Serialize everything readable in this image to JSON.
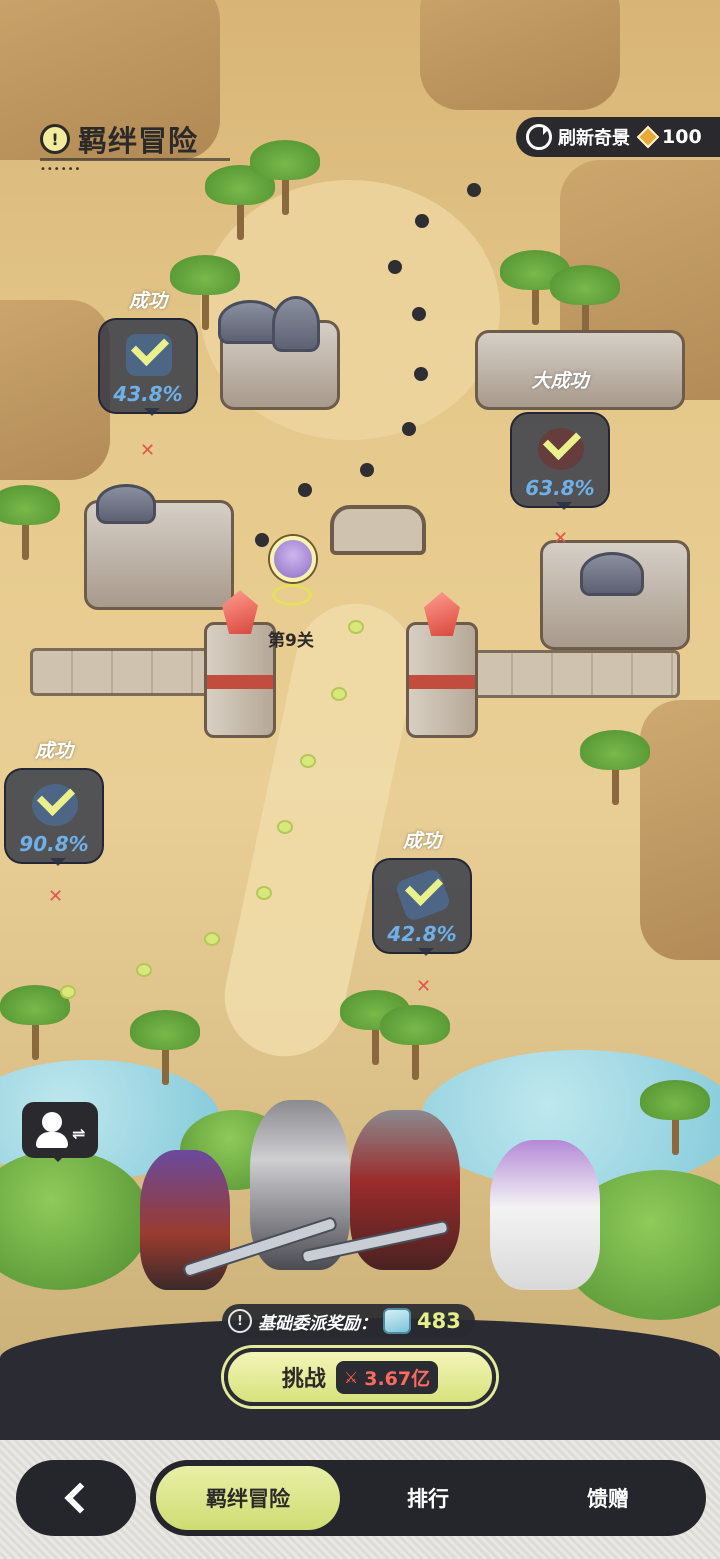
{
  "header": {
    "info_icon": "!",
    "title": "羁绊冒险",
    "refresh_label": "刷新奇景",
    "refresh_cost": "100"
  },
  "map": {
    "nodes": [
      {
        "label": "成功",
        "pct": "43.8%"
      },
      {
        "label": "大成功",
        "pct": "63.8%"
      },
      {
        "label": "成功",
        "pct": "90.8%"
      },
      {
        "label": "成功",
        "pct": "42.8%"
      }
    ],
    "stage_label": "第9关"
  },
  "bottom": {
    "reward_info_icon": "!",
    "reward_label": "基础委派奖励：",
    "reward_value": "483",
    "challenge_label": "挑战",
    "power_icon": "⚔",
    "power_value": "3.67亿"
  },
  "nav": {
    "tabs": [
      "羁绊冒险",
      "排行",
      "馈赠"
    ]
  }
}
